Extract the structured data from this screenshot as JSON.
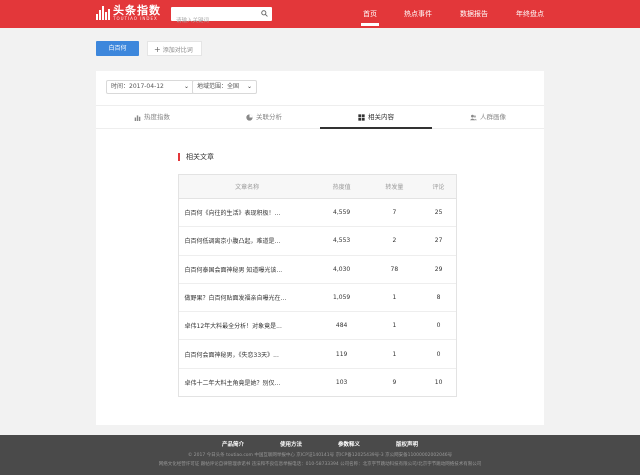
{
  "header": {
    "logo_title": "头条指数",
    "logo_sub": "TOUTIAO INDEX",
    "search_placeholder": "请输入关键词",
    "nav": [
      "首页",
      "热点事件",
      "数据报告",
      "年终盘点"
    ],
    "active_nav": 0,
    "colors": {
      "brand": "#e3373a"
    }
  },
  "actions": {
    "primary_label": "白百何",
    "add_label": "添加对比词"
  },
  "filters": {
    "time_label": "时间：2017-04-12",
    "region_label": "地域范围：全国"
  },
  "tabs": [
    {
      "label": "热度指数",
      "icon": "bar-chart-icon"
    },
    {
      "label": "关联分析",
      "icon": "pie-chart-icon"
    },
    {
      "label": "相关内容",
      "icon": "grid-icon"
    },
    {
      "label": "人群画像",
      "icon": "users-icon"
    }
  ],
  "active_tab": 2,
  "section_title": "相关文章",
  "table": {
    "headers": [
      "文章名称",
      "热度值",
      "转发量",
      "评论"
    ],
    "rows": [
      [
        "白百何《向往的生活》表现积极！...",
        "4,559",
        "7",
        "25"
      ],
      [
        "白百何低调离京小腹凸起，难道是...",
        "4,553",
        "2",
        "27"
      ],
      [
        "白百何泰国会面神秘男 知道曝光该...",
        "4,030",
        "78",
        "29"
      ],
      [
        "做野果？白百何贴面发福亲自曝光在...",
        "1,059",
        "1",
        "8"
      ],
      [
        "卓伟12年大料最全分析！对象竟是...",
        "484",
        "1",
        "0"
      ],
      [
        "白百何会面神秘男，《失恋33天》...",
        "119",
        "1",
        "0"
      ],
      [
        "卓伟十二年大料主角竟是她？别仅...",
        "103",
        "9",
        "10"
      ]
    ]
  },
  "footer": {
    "links": [
      "产品简介",
      "使用方法",
      "参数释义",
      "版权声明"
    ],
    "line1": "© 2017 今日头条 toutiao.com  中国互联网举报中心  京ICP证140141号  京ICP备12025439号-3  京公网安备11000002002046号",
    "line2": "网络文化经营许可证  跟帖评论自律管理承诺书  违法和不良信息举报电话：010-58733394  公司名称：北京字节跳动科技有限公司/北京字节跳动网络技术有限公司"
  }
}
